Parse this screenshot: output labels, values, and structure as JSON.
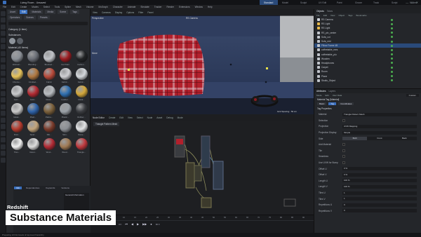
{
  "window": {
    "title": "Living Room - Unsaved"
  },
  "layouts": [
    "Standard",
    "Model",
    "Sculpt",
    "UV Edit",
    "Paint",
    "Groom",
    "Track",
    "Script",
    "Nodes"
  ],
  "menu": [
    "File",
    "Edit",
    "Create",
    "Modes",
    "Select",
    "Tools",
    "Spline",
    "Mesh",
    "Volume",
    "MoGraph",
    "Character",
    "Animate",
    "Simulate",
    "Tracker",
    "Render",
    "Extensions",
    "Window",
    "Help"
  ],
  "assets": {
    "tabs": [
      "Asset",
      "Edit",
      "Materials",
      "Media",
      "Scene",
      "Tags"
    ],
    "subtabs": [
      "Operators",
      "Scenes",
      "Presets"
    ],
    "category": "Category (1 Item)",
    "section1": "Substances",
    "section2": "Material (40 Items)",
    "items": [
      {
        "label": "Abstract...",
        "color": "#8a8f96"
      },
      {
        "label": "Blending...",
        "color": "#6a6e76"
      },
      {
        "label": "Brushed...",
        "color": "#c0c3c8"
      },
      {
        "label": "Car Paint",
        "color": "#9b1b20"
      },
      {
        "label": "Carbon...",
        "color": "#222426"
      },
      {
        "label": "Chrome...",
        "color": "#e6c25a"
      },
      {
        "label": "Crinkled...",
        "color": "#b07840"
      },
      {
        "label": "Fabric",
        "color": "#b84a3a"
      },
      {
        "label": "Fabric...",
        "color": "#cfcfd3"
      },
      {
        "label": "Fabric...",
        "color": "#d4d8dc"
      },
      {
        "label": "Gem...",
        "color": "#c8cacd"
      },
      {
        "label": "Gold...",
        "color": "#b42a32"
      },
      {
        "label": "Glass...",
        "color": "#b8bcc0"
      },
      {
        "label": "Leather...",
        "color": "#2f6fb0"
      },
      {
        "label": "Metal...",
        "color": "#d4a83a"
      },
      {
        "label": "Metal...",
        "color": "#c9c9c9"
      },
      {
        "label": "Plaid...",
        "color": "#2e62a8"
      },
      {
        "label": "Patina...",
        "color": "#7a5f3a"
      },
      {
        "label": "Plastic...",
        "color": "#9aa0a6"
      },
      {
        "label": "Rubber...",
        "color": "#3a3c40"
      },
      {
        "label": "Rust...",
        "color": "#b43a2c"
      },
      {
        "label": "Sand...",
        "color": "#c2a47a"
      },
      {
        "label": "Silk...",
        "color": "#7a3a2a"
      },
      {
        "label": "Skin...",
        "color": "#8c8f94"
      },
      {
        "label": "Stone...",
        "color": "#e3e4e6"
      },
      {
        "label": "Tiles...",
        "color": "#f0f0f0"
      },
      {
        "label": "Velvet...",
        "color": "#dcdcdc"
      },
      {
        "label": "Wool...",
        "color": "#b22a34"
      },
      {
        "label": "Wood...",
        "color": "#a07a54"
      },
      {
        "label": "Triangle...",
        "color": "#c0393e"
      }
    ],
    "info_title": "General Information"
  },
  "viewport": {
    "menu": [
      "View",
      "Cameras",
      "Display",
      "Options",
      "Filter",
      "Panel"
    ],
    "label": "Perspective",
    "camera": "RS Camera",
    "move": "Move",
    "grid": "Grid Spacing : 50 cm"
  },
  "node_editor": {
    "menu": [
      "Create",
      "Edit",
      "View",
      "Select",
      "Node",
      "Asset",
      "Debug",
      "Mode"
    ],
    "title": "Node Editor",
    "node_label": "Triangle Pattern Mesh"
  },
  "timeline": {
    "frames": [
      "0",
      "5",
      "10",
      "15",
      "20",
      "25",
      "30",
      "35",
      "40",
      "45",
      "50",
      "55",
      "60",
      "65",
      "70",
      "75",
      "80",
      "85",
      "90"
    ],
    "start": "0 F",
    "end": "90 F"
  },
  "objects": {
    "tabs": [
      "Objects",
      "Takes"
    ],
    "menu": [
      "File",
      "Edit",
      "View",
      "Object",
      "Tags",
      "Bookmarks"
    ],
    "rows": [
      {
        "name": "RS Camera",
        "color": "#d0d4da"
      },
      {
        "name": "RS Light",
        "color": "#e6b84a"
      },
      {
        "name": "RS Light",
        "color": "#e6b84a"
      },
      {
        "name": "RS_pin_center",
        "color": "#c0c4ca"
      },
      {
        "name": "Sofa_cut",
        "color": "#c0c4ca"
      },
      {
        "name": "Sofa_mid",
        "color": "#c0c4ca"
      },
      {
        "name": "Pillow Frame 4B",
        "color": "#c0c4ca"
      },
      {
        "name": "coffeetable_mes",
        "color": "#c0c4ca"
      },
      {
        "name": "coffeetable_plu",
        "color": "#c0c4ca"
      },
      {
        "name": "Wooden",
        "color": "#c0c4ca"
      },
      {
        "name": "Headphones",
        "color": "#c0c4ca"
      },
      {
        "name": "Carpet",
        "color": "#c0c4ca"
      },
      {
        "name": "Room",
        "color": "#c0c4ca"
      },
      {
        "name": "Plane",
        "color": "#c0c4ca"
      },
      {
        "name": "Studio_Object",
        "color": "#c0c4ca"
      }
    ]
  },
  "attributes": {
    "tabs": [
      "Attributes",
      "Layers"
    ],
    "menu": [
      "Mode",
      "Edit",
      "User Data"
    ],
    "mode": "Custom",
    "tag_title": "Material Tag [Material]",
    "subtabs": [
      "Basic",
      "Tag",
      "Coordinates"
    ],
    "section": "Tag Properties",
    "rows": [
      {
        "k": "Material",
        "v": "Triangle Pattern Mesh"
      },
      {
        "k": "Selection",
        "v": ""
      },
      {
        "k": "Projection",
        "v": "UVW Mapping"
      },
      {
        "k": "Projection Display",
        "v": "Simple"
      },
      {
        "k": "Side",
        "v": "Both"
      },
      {
        "k": "Add Material",
        "v": ""
      },
      {
        "k": "Tile",
        "v": ""
      },
      {
        "k": "Seamless",
        "v": ""
      },
      {
        "k": "Use UVW for Bump",
        "v": ""
      },
      {
        "k": "Offset U",
        "v": "0 %"
      },
      {
        "k": "Offset V",
        "v": "0 %"
      },
      {
        "k": "Length U",
        "v": "100 %"
      },
      {
        "k": "Length V",
        "v": "100 %"
      },
      {
        "k": "Tiles U",
        "v": "1"
      },
      {
        "k": "Tiles V",
        "v": "1"
      },
      {
        "k": "Repetitions U",
        "v": "0"
      },
      {
        "k": "Repetitions V",
        "v": "0"
      }
    ],
    "side_opts": [
      "Both",
      "Front",
      "Back"
    ]
  },
  "banner": {
    "small": "Redshift",
    "big": "Substance Materials"
  },
  "status": "Preparing 4/4 list levels of top-level hierarchy"
}
